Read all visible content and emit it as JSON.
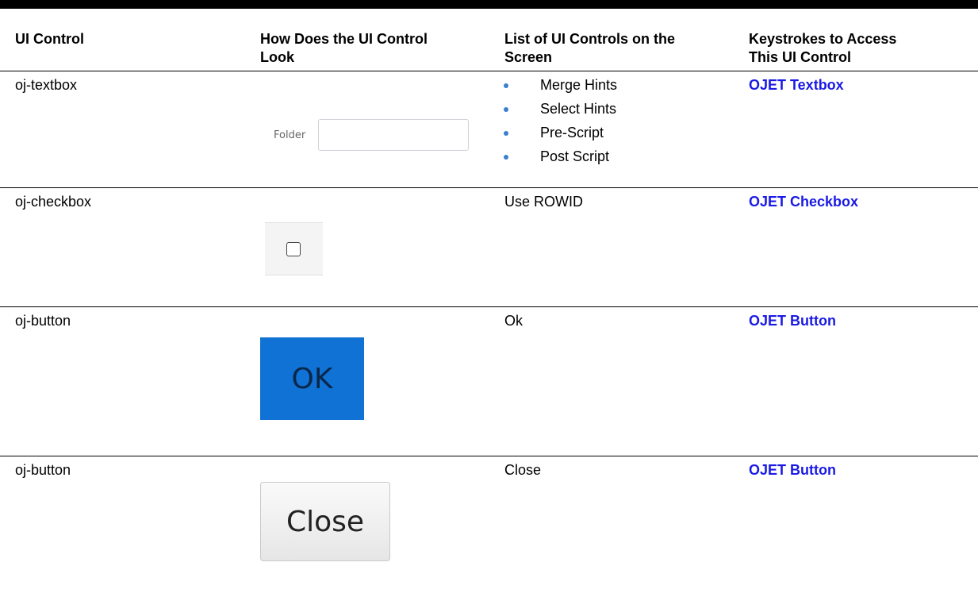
{
  "table": {
    "headers": [
      {
        "line1": "UI Control",
        "line2": ""
      },
      {
        "line1": "How Does the UI Control",
        "line2": "Look"
      },
      {
        "line1": "List of UI Controls on the",
        "line2": "Screen"
      },
      {
        "line1": "Keystrokes to Access",
        "line2": "This UI Control"
      }
    ],
    "rows": [
      {
        "control": "oj-textbox",
        "preview": {
          "label": "Folder"
        },
        "items": [
          "Merge Hints",
          "Select Hints",
          "Pre-Script",
          "Post Script"
        ],
        "link": "OJET Textbox"
      },
      {
        "control": "oj-checkbox",
        "controls_text": "Use ROWID",
        "link": "OJET Checkbox"
      },
      {
        "control": "oj-button",
        "preview": {
          "label": "OK"
        },
        "controls_text": "Ok",
        "link": "OJET Button"
      },
      {
        "control": "oj-button",
        "preview": {
          "label": "Close"
        },
        "controls_text": "Close",
        "link": "OJET Button"
      }
    ]
  },
  "colors": {
    "link": "#1a1ae6",
    "bullet": "#3a7fd0",
    "ok_button": "#0f72d4"
  }
}
